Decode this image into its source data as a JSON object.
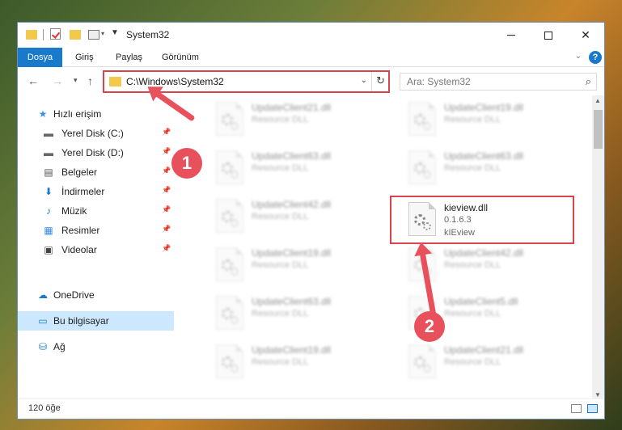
{
  "window": {
    "title": "System32",
    "controls": {
      "minimize": "minimize",
      "maximize": "maximize",
      "close": "✕"
    }
  },
  "ribbon": {
    "tabs": [
      {
        "label": "Dosya"
      },
      {
        "label": "Giriş"
      },
      {
        "label": "Paylaş"
      },
      {
        "label": "Görünüm"
      }
    ],
    "help": "?"
  },
  "address": {
    "path": "C:\\Windows\\System32",
    "search_placeholder": "Ara: System32"
  },
  "nav": {
    "items": [
      {
        "label": "Hızlı erişim",
        "icon": "star-icon",
        "pinned": false
      },
      {
        "label": "Yerel Disk (C:)",
        "icon": "drive-icon",
        "pinned": true
      },
      {
        "label": "Yerel Disk (D:)",
        "icon": "drive-icon",
        "pinned": true
      },
      {
        "label": "Belgeler",
        "icon": "documents-icon",
        "pinned": true
      },
      {
        "label": "İndirmeler",
        "icon": "download-icon",
        "pinned": true
      },
      {
        "label": "Müzik",
        "icon": "music-icon",
        "pinned": true
      },
      {
        "label": "Resimler",
        "icon": "pictures-icon",
        "pinned": true
      },
      {
        "label": "Videolar",
        "icon": "video-icon",
        "pinned": true
      },
      {
        "label": "OneDrive",
        "icon": "cloud-icon",
        "pinned": false
      },
      {
        "label": "Bu bilgisayar",
        "icon": "computer-icon",
        "pinned": false,
        "selected": true
      },
      {
        "label": "Ağ",
        "icon": "network-icon",
        "pinned": false
      }
    ]
  },
  "files": [
    {
      "name": "UpdateClient21.dll",
      "type": "Resource DLL",
      "blurred": true
    },
    {
      "name": "UpdateClient19.dll",
      "type": "Resource DLL",
      "blurred": true
    },
    {
      "name": "UpdateClient63.dll",
      "type": "Resource DLL",
      "blurred": true
    },
    {
      "name": "UpdateClient63.dll",
      "type": "Resource DLL",
      "blurred": true
    },
    {
      "name": "UpdateClient42.dll",
      "type": "Resource DLL",
      "blurred": true
    },
    {
      "name": "kieview.dll",
      "version": "0.1.6.3",
      "type": "kIEview",
      "blurred": false,
      "highlighted": true
    },
    {
      "name": "UpdateClient19.dll",
      "type": "Resource DLL",
      "blurred": true
    },
    {
      "name": "UpdateClient42.dll",
      "type": "Resource DLL",
      "blurred": true
    },
    {
      "name": "UpdateClient63.dll",
      "type": "Resource DLL",
      "blurred": true
    },
    {
      "name": "UpdateClient5.dll",
      "type": "Resource DLL",
      "blurred": true
    },
    {
      "name": "UpdateClient19.dll",
      "type": "Resource DLL",
      "blurred": true
    },
    {
      "name": "UpdateClient21.dll",
      "type": "Resource DLL",
      "blurred": true
    }
  ],
  "status": {
    "count": "120 öğe"
  },
  "annotations": {
    "step1": "1",
    "step2": "2",
    "color": "#e8505b"
  }
}
